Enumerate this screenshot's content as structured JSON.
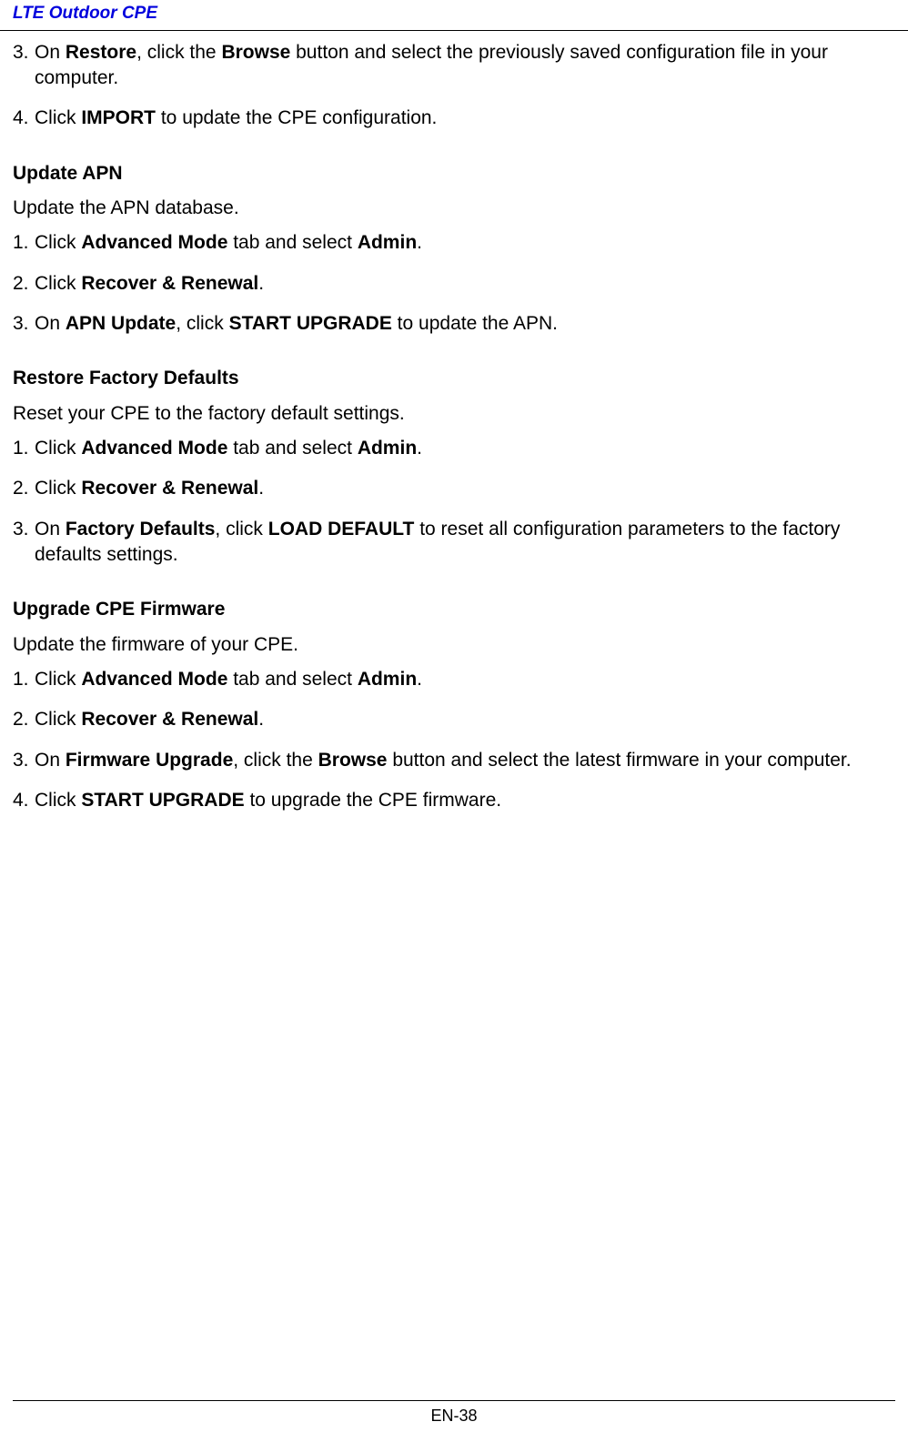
{
  "header": "LTE Outdoor CPE",
  "section0": {
    "items": [
      {
        "num": "3.",
        "parts": [
          {
            "t": "On "
          },
          {
            "t": "Restore",
            "b": true
          },
          {
            "t": ", click the "
          },
          {
            "t": "Browse",
            "b": true
          },
          {
            "t": " button and select the previously saved configuration file in your computer."
          }
        ]
      },
      {
        "num": "4.",
        "parts": [
          {
            "t": "Click "
          },
          {
            "t": "IMPORT",
            "b": true
          },
          {
            "t": " to update the CPE configuration."
          }
        ]
      }
    ]
  },
  "section1": {
    "heading": "Update APN",
    "intro": "Update the APN database.",
    "items": [
      {
        "num": "1.",
        "parts": [
          {
            "t": "Click "
          },
          {
            "t": "Advanced Mode",
            "b": true
          },
          {
            "t": " tab and select "
          },
          {
            "t": "Admin",
            "b": true
          },
          {
            "t": "."
          }
        ]
      },
      {
        "num": "2.",
        "parts": [
          {
            "t": "Click "
          },
          {
            "t": "Recover & Renewal",
            "b": true
          },
          {
            "t": "."
          }
        ]
      },
      {
        "num": "3.",
        "parts": [
          {
            "t": "On "
          },
          {
            "t": "APN Update",
            "b": true
          },
          {
            "t": ", click "
          },
          {
            "t": "START UPGRADE",
            "b": true
          },
          {
            "t": " to update the APN."
          }
        ]
      }
    ]
  },
  "section2": {
    "heading": "Restore Factory Defaults",
    "intro": "Reset your CPE to the factory default settings.",
    "items": [
      {
        "num": "1.",
        "parts": [
          {
            "t": "Click "
          },
          {
            "t": "Advanced Mode",
            "b": true
          },
          {
            "t": " tab and select "
          },
          {
            "t": "Admin",
            "b": true
          },
          {
            "t": "."
          }
        ]
      },
      {
        "num": "2.",
        "parts": [
          {
            "t": "Click "
          },
          {
            "t": "Recover & Renewal",
            "b": true
          },
          {
            "t": "."
          }
        ]
      },
      {
        "num": "3.",
        "parts": [
          {
            "t": "On "
          },
          {
            "t": "Factory Defaults",
            "b": true
          },
          {
            "t": ", click "
          },
          {
            "t": "LOAD DEFAULT",
            "b": true
          },
          {
            "t": " to reset all configuration parameters to the factory defaults settings."
          }
        ]
      }
    ]
  },
  "section3": {
    "heading": "Upgrade CPE Firmware",
    "intro": "Update the firmware of your CPE.",
    "items": [
      {
        "num": "1.",
        "parts": [
          {
            "t": "Click "
          },
          {
            "t": "Advanced Mode",
            "b": true
          },
          {
            "t": " tab and select "
          },
          {
            "t": "Admin",
            "b": true
          },
          {
            "t": "."
          }
        ]
      },
      {
        "num": "2.",
        "parts": [
          {
            "t": "Click "
          },
          {
            "t": "Recover & Renewal",
            "b": true
          },
          {
            "t": "."
          }
        ]
      },
      {
        "num": "3.",
        "parts": [
          {
            "t": "On "
          },
          {
            "t": "Firmware Upgrade",
            "b": true
          },
          {
            "t": ", click the "
          },
          {
            "t": "Browse",
            "b": true
          },
          {
            "t": " button and select the latest firmware in your computer."
          }
        ]
      },
      {
        "num": "4.",
        "parts": [
          {
            "t": "Click "
          },
          {
            "t": "START UPGRADE",
            "b": true
          },
          {
            "t": " to upgrade the CPE firmware."
          }
        ]
      }
    ]
  },
  "pageNum": "EN-38"
}
